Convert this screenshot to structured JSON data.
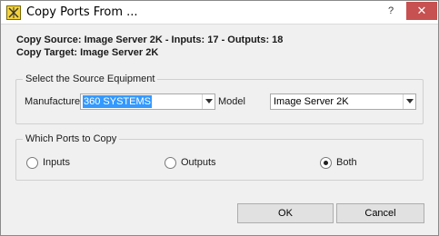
{
  "window": {
    "title": "Copy Ports From ...",
    "help_label": "?",
    "close_label": "✕"
  },
  "info": {
    "source_line": "Copy Source: Image Server 2K - Inputs: 17 - Outputs: 18",
    "target_line": "Copy Target: Image Server 2K"
  },
  "source_group": {
    "title": "Select the Source Equipment",
    "manufacturer_label": "Manufacturer",
    "manufacturer_value": "360 SYSTEMS",
    "model_label": "Model",
    "model_value": "Image Server 2K"
  },
  "ports_group": {
    "title": "Which Ports to Copy",
    "options": [
      {
        "label": "Inputs",
        "selected": false
      },
      {
        "label": "Outputs",
        "selected": false
      },
      {
        "label": "Both",
        "selected": true
      }
    ]
  },
  "buttons": {
    "ok_label": "OK",
    "cancel_label": "Cancel"
  },
  "icons": {
    "app": "app-logo-icon",
    "dropdown": "chevron-down-icon"
  },
  "colors": {
    "close_button": "#c75050",
    "selection": "#3399ff"
  }
}
